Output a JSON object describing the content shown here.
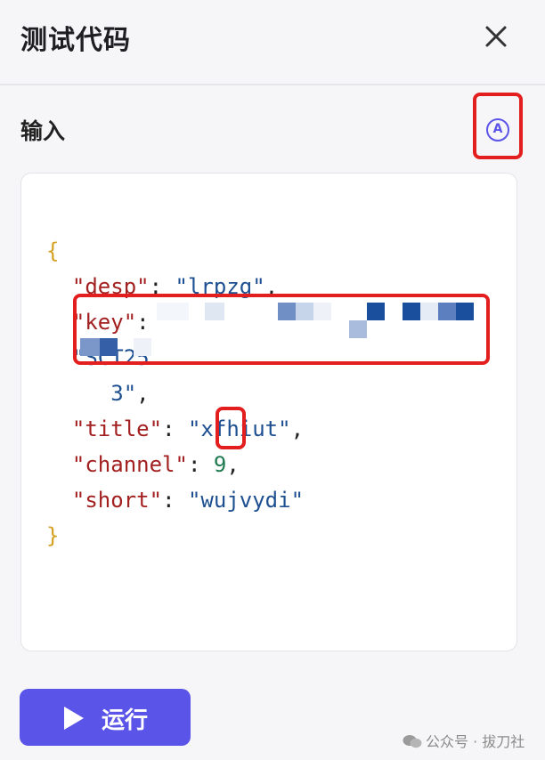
{
  "header": {
    "title": "测试代码"
  },
  "input": {
    "label": "输入",
    "format_icon_letter": "A"
  },
  "code": {
    "open_brace": "{",
    "close_brace": "}",
    "desp_key": "\"desp\"",
    "desp_value": "\"lrpzg\"",
    "key_key": "\"key\"",
    "key_value_start": "\"SCT25",
    "key_value_end": "3\"",
    "title_key": "\"title\"",
    "title_value": "\"xfhiut\"",
    "channel_key": "\"channel\"",
    "channel_value": "9",
    "short_key": "\"short\"",
    "short_value": "\"wujvydi\"",
    "colon": ": ",
    "comma": ","
  },
  "run_button": {
    "label": "运行"
  },
  "watermark": {
    "text": "公众号 · 拔刀社"
  },
  "colors": {
    "accent": "#5b54e8",
    "highlight": "#e31e1e",
    "key": "#a32020",
    "string": "#1d4f91",
    "number": "#1f7a50",
    "brace": "#d4a021"
  }
}
